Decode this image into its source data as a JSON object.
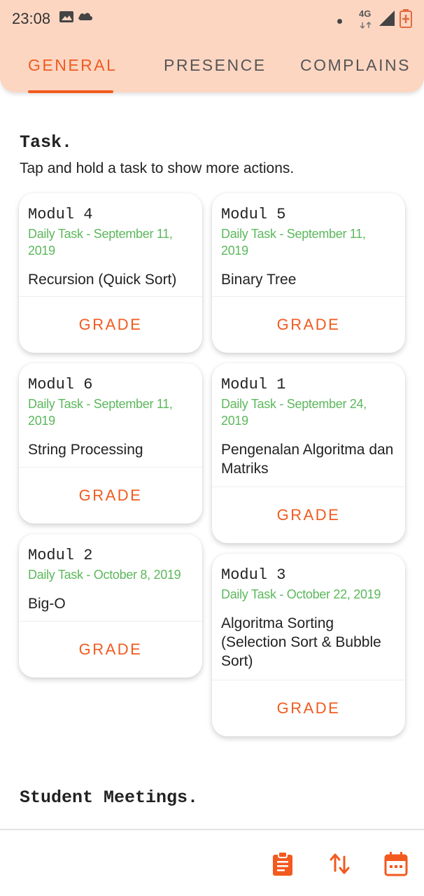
{
  "status_bar": {
    "time": "23:08",
    "network": "4G",
    "icons": [
      "image-icon",
      "cloud-icon",
      "dot-icon",
      "signal-icon",
      "battery-icon"
    ]
  },
  "tabs": [
    {
      "label": "GENERAL",
      "active": true
    },
    {
      "label": "PRESENCE",
      "active": false
    },
    {
      "label": "COMPLAINS",
      "active": false
    }
  ],
  "task_section": {
    "title": "Task.",
    "subtitle": "Tap and hold a task to show more actions."
  },
  "tasks": [
    {
      "title": "Modul 4",
      "date": "Daily Task - September 11, 2019",
      "description": "Recursion (Quick Sort)",
      "action": "GRADE"
    },
    {
      "title": "Modul 5",
      "date": "Daily Task - September 11, 2019",
      "description": "Binary Tree",
      "action": "GRADE"
    },
    {
      "title": "Modul 6",
      "date": "Daily Task - September 11, 2019",
      "description": "String Processing",
      "action": "GRADE"
    },
    {
      "title": "Modul 1",
      "date": "Daily Task - September 24, 2019",
      "description": "Pengenalan Algoritma dan Matriks",
      "action": "GRADE"
    },
    {
      "title": "Modul 2",
      "date": "Daily Task - October 8, 2019",
      "description": "Big-O",
      "action": "GRADE"
    },
    {
      "title": "Modul 3",
      "date": "Daily Task - October 22, 2019",
      "description": "Algoritma Sorting (Selection Sort & Bubble Sort)",
      "action": "GRADE"
    }
  ],
  "meetings_section": {
    "title": "Student Meetings."
  },
  "bottom_bar": {
    "icons": [
      "clipboard-icon",
      "sort-icon",
      "calendar-icon"
    ]
  },
  "colors": {
    "accent": "#f25a1f",
    "header_bg": "#fdd6c2",
    "date_green": "#5cb85c"
  }
}
